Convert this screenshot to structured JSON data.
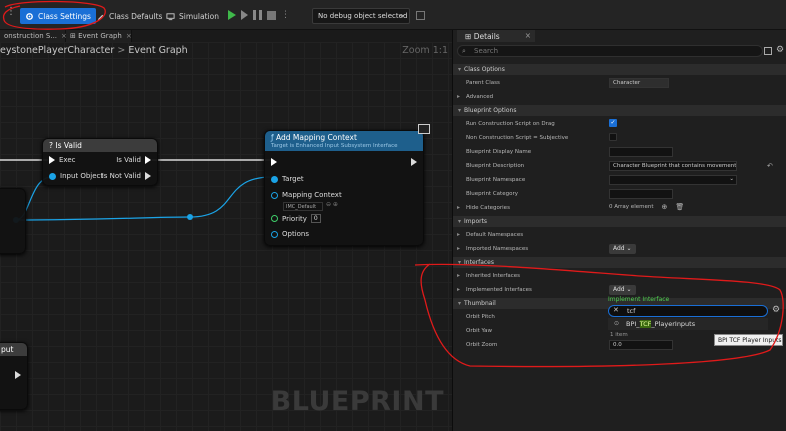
{
  "toolbar": {
    "class_settings": "Class Settings",
    "class_defaults": "Class Defaults",
    "simulation": "Simulation",
    "debug_object": "No debug object selected"
  },
  "tabs": [
    {
      "label": "onstruction S..."
    },
    {
      "label": "Event Graph"
    }
  ],
  "graph": {
    "breadcrumb": "eystonePlayerCharacter",
    "breadcrumb_separator": ">",
    "breadcrumb_page": "Event Graph",
    "zoom": "Zoom 1:1",
    "watermark": "BLUEPRINT"
  },
  "nodes": {
    "is_valid": {
      "title": "? Is Valid",
      "exec_in": "Exec",
      "is_valid_out": "Is Valid",
      "input_object": "Input Object",
      "is_not_valid_out": "Is Not Valid"
    },
    "add_mapping_context": {
      "title": "Add Mapping Context",
      "subtitle": "Target is Enhanced Input Subsystem Interface",
      "target": "Target",
      "mapping_context_label": "Mapping Context",
      "mapping_context_value": "IMC_Default",
      "priority_label": "Priority",
      "priority_value": "0",
      "options": "Options"
    },
    "partial_left": {
      "title": "put"
    }
  },
  "details": {
    "tab_label": "Details",
    "search_placeholder": "Search",
    "categories": {
      "class_options": "Class Options",
      "blueprint_options": "Blueprint Options",
      "imports": "Imports",
      "interfaces": "Interfaces",
      "thumbnail": "Thumbnail"
    },
    "rows": {
      "parent_class": "Parent Class",
      "parent_class_value": "Character",
      "advanced": "Advanced",
      "run_construction_script_on_drag": "Run Construction Script on Drag",
      "non_construction_script": "Non Construction Script = Subjective",
      "blueprint_display_name": "Blueprint Display Name",
      "blueprint_description": "Blueprint Description",
      "blueprint_description_value": "Character Blueprint that contains movement logic",
      "blueprint_namespace": "Blueprint Namespace",
      "blueprint_category": "Blueprint Category",
      "hide_categories": "Hide Categories",
      "hide_categories_value": "0 Array element",
      "default_namespaces": "Default Namespaces",
      "imported_namespaces": "Imported Namespaces",
      "inherited_interfaces": "Inherited Interfaces",
      "implemented_interfaces": "Implemented Interfaces",
      "orbit_pitch": "Orbit Pitch",
      "orbit_yaw": "Orbit Yaw",
      "orbit_zoom": "Orbit Zoom",
      "orbit_zoom_value": "0.0",
      "add": "Add"
    }
  },
  "popup": {
    "title": "Implement Interface",
    "search_value": "tcf",
    "item_prefix": "BPI_",
    "item_match": "TCF",
    "item_suffix": "_PlayerInputs",
    "count": "1 item",
    "tooltip": "BPI TCF Player Inputs"
  },
  "colors": {
    "accent": "#1a6fd6",
    "annotation": "#e01a1a",
    "function_header": "#1e5f8c",
    "pure_header": "#3c3c3c",
    "exec_wire": "#ffffff",
    "object_wire": "#1ba3e6",
    "popup_title": "#4fd04f"
  }
}
